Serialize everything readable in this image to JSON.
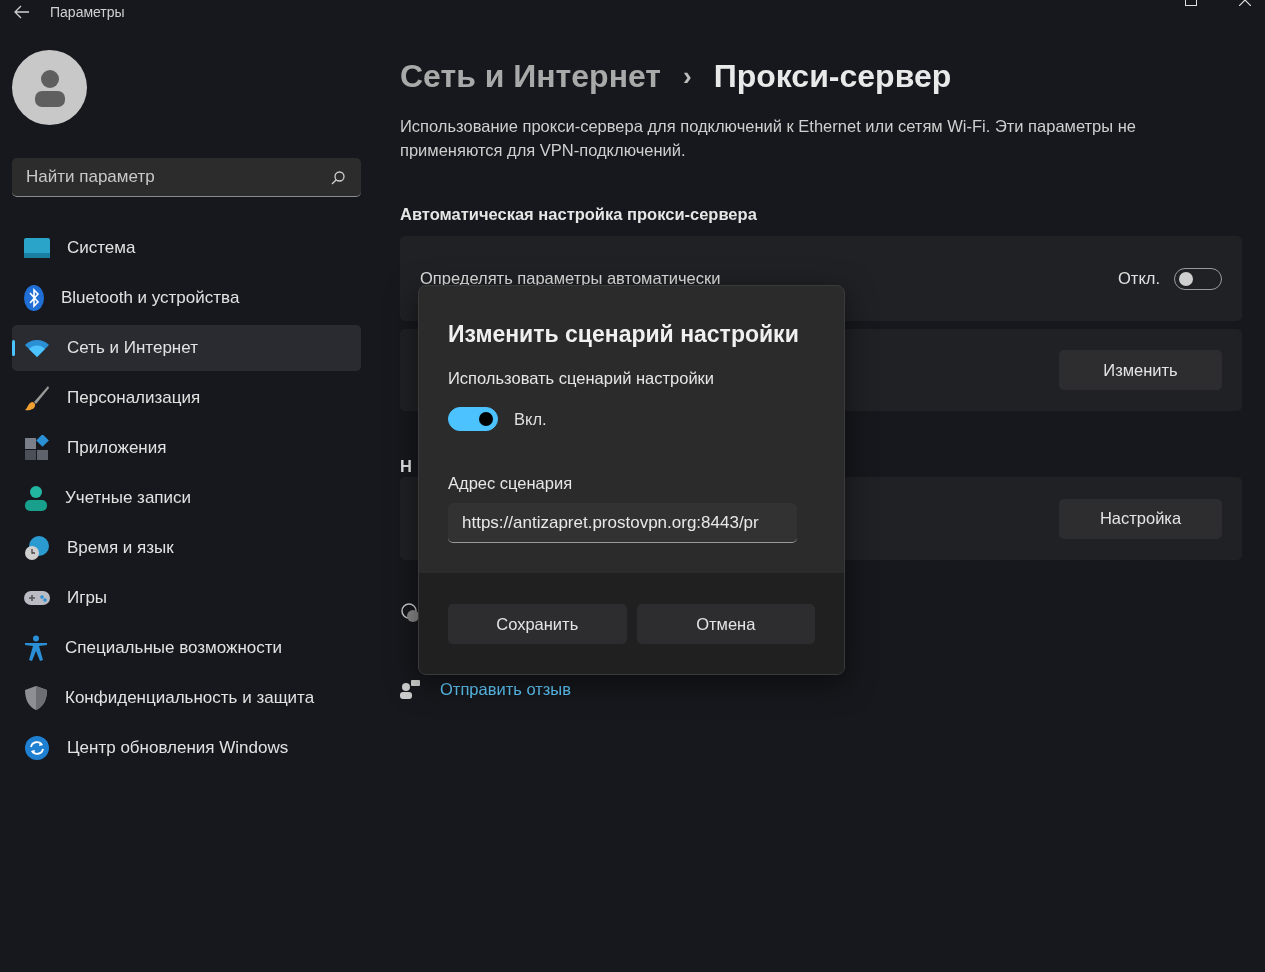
{
  "window": {
    "title": "Параметры"
  },
  "search": {
    "placeholder": "Найти параметр"
  },
  "nav": [
    {
      "label": "Система",
      "selected": false
    },
    {
      "label": "Bluetooth и устройства",
      "selected": false
    },
    {
      "label": "Сеть и Интернет",
      "selected": true
    },
    {
      "label": "Персонализация",
      "selected": false
    },
    {
      "label": "Приложения",
      "selected": false
    },
    {
      "label": "Учетные записи",
      "selected": false
    },
    {
      "label": "Время и язык",
      "selected": false
    },
    {
      "label": "Игры",
      "selected": false
    },
    {
      "label": "Специальные возможности",
      "selected": false
    },
    {
      "label": "Конфиденциальность и защита",
      "selected": false
    },
    {
      "label": "Центр обновления Windows",
      "selected": false
    }
  ],
  "breadcrumb": {
    "parent": "Сеть и Интернет",
    "separator": "›",
    "current": "Прокси-сервер"
  },
  "description": "Использование прокси-сервера для подключений к Ethernet или сетям Wi-Fi. Эти параметры не применяются для VPN-подключений.",
  "auto_section": {
    "heading": "Автоматическая настройка прокси-сервера",
    "detect_row": {
      "label": "Определять параметры автоматически",
      "state": "Откл.",
      "on": false
    },
    "script_row": {
      "button": "Изменить"
    }
  },
  "manual_section": {
    "heading": "Н",
    "row": {
      "button": "Настройка"
    }
  },
  "links": [
    "Отправить отзыв"
  ],
  "dialog": {
    "title": "Изменить сценарий настройки",
    "toggle_label": "Использовать сценарий настройки",
    "toggle_state": "Вкл.",
    "on": true,
    "address_label": "Адрес сценария",
    "address_value": "https://antizapret.prostovpn.org:8443/pr",
    "buttons": [
      "Сохранить",
      "Отмена"
    ]
  }
}
